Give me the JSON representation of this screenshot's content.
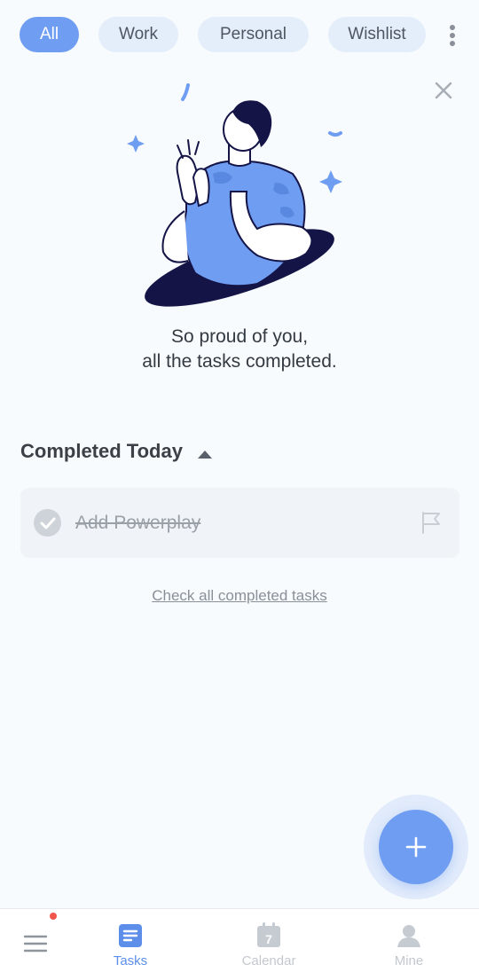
{
  "tabs": [
    {
      "label": "All",
      "active": true
    },
    {
      "label": "Work",
      "active": false
    },
    {
      "label": "Personal",
      "active": false
    },
    {
      "label": "Wishlist",
      "active": false
    }
  ],
  "message": {
    "line1": "So proud of you,",
    "line2": "all the tasks completed."
  },
  "completed_section": {
    "title": "Completed Today",
    "tasks": [
      {
        "title": "Add Powerplay",
        "completed": true
      }
    ]
  },
  "check_all_link": "Check all completed tasks",
  "bottom_nav": {
    "items": [
      {
        "label": "",
        "icon": "menu-icon",
        "badge": true
      },
      {
        "label": "Tasks",
        "icon": "tasks-icon",
        "active": true
      },
      {
        "label": "Calendar",
        "icon": "calendar-icon",
        "active": false,
        "icon_text": "7"
      },
      {
        "label": "Mine",
        "icon": "profile-icon",
        "active": false
      }
    ]
  },
  "colors": {
    "accent": "#6F9DF1",
    "chip_bg": "#E4EEFB",
    "background": "#F7FBFD",
    "badge": "#F2554B"
  }
}
